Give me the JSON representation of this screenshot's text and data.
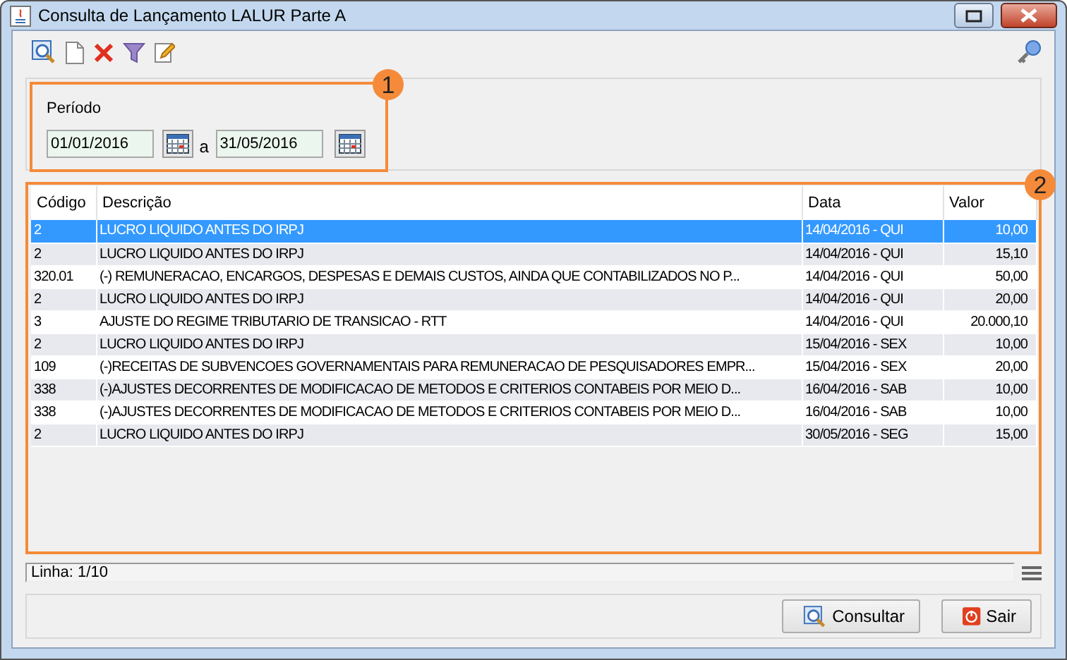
{
  "window": {
    "title": "Consulta de Lançamento LALUR Parte A"
  },
  "period": {
    "label": "Período",
    "start": "01/01/2016",
    "separator": "a",
    "end": "31/05/2016"
  },
  "callouts": [
    "1",
    "2"
  ],
  "table": {
    "columns": [
      "Código",
      "Descrição",
      "Data",
      "Valor"
    ],
    "rows": [
      {
        "codigo": "2",
        "descricao": "LUCRO LIQUIDO ANTES DO IRPJ",
        "data": "14/04/2016 - QUI",
        "valor": "10,00",
        "selected": true
      },
      {
        "codigo": "2",
        "descricao": "LUCRO LIQUIDO ANTES DO IRPJ",
        "data": "14/04/2016 - QUI",
        "valor": "15,10",
        "selected": false
      },
      {
        "codigo": "320.01",
        "descricao": "(-) REMUNERACAO, ENCARGOS, DESPESAS E DEMAIS CUSTOS, AINDA QUE CONTABILIZADOS NO P...",
        "data": "14/04/2016 - QUI",
        "valor": "50,00",
        "selected": false
      },
      {
        "codigo": "2",
        "descricao": "LUCRO LIQUIDO ANTES DO IRPJ",
        "data": "14/04/2016 - QUI",
        "valor": "20,00",
        "selected": false
      },
      {
        "codigo": "3",
        "descricao": "AJUSTE DO REGIME TRIBUTARIO DE TRANSICAO - RTT",
        "data": "14/04/2016 - QUI",
        "valor": "20.000,10",
        "selected": false
      },
      {
        "codigo": "2",
        "descricao": "LUCRO LIQUIDO ANTES DO IRPJ",
        "data": "15/04/2016 - SEX",
        "valor": "10,00",
        "selected": false
      },
      {
        "codigo": "109",
        "descricao": "(-)RECEITAS DE SUBVENCOES GOVERNAMENTAIS PARA REMUNERACAO DE PESQUISADORES EMPR...",
        "data": "15/04/2016 - SEX",
        "valor": "20,00",
        "selected": false
      },
      {
        "codigo": "338",
        "descricao": "(-)AJUSTES DECORRENTES DE MODIFICACAO DE METODOS E CRITERIOS CONTABEIS POR MEIO D...",
        "data": "16/04/2016 - SAB",
        "valor": "10,00",
        "selected": false
      },
      {
        "codigo": "338",
        "descricao": "(-)AJUSTES DECORRENTES DE MODIFICACAO DE METODOS E CRITERIOS CONTABEIS POR MEIO D...",
        "data": "16/04/2016 - SAB",
        "valor": "10,00",
        "selected": false
      },
      {
        "codigo": "2",
        "descricao": "LUCRO LIQUIDO ANTES DO IRPJ",
        "data": "30/05/2016 - SEG",
        "valor": "15,00",
        "selected": false
      }
    ]
  },
  "status_bar": {
    "text": "Linha: 1/10"
  },
  "buttons": [
    {
      "kind": "search",
      "label": "Consultar"
    },
    {
      "kind": "exit",
      "label": "Sair"
    }
  ]
}
